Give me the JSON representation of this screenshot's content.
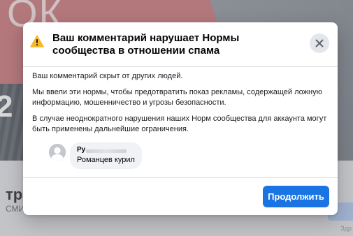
{
  "background": {
    "banner_text": "ОК",
    "banner_number": "2",
    "title": "тра",
    "subtitle": "СМИ/",
    "note": "Здр"
  },
  "dialog": {
    "title": "Ваш комментарий нарушает Нормы сообщества в отношении спама",
    "icon": "warning-triangle-icon",
    "close_icon": "close-icon",
    "paragraphs": [
      "Ваш комментарий скрыт от других людей.",
      "Мы ввели эти нормы, чтобы предотвратить показ рекламы, содержащей ложную информацию, мошенничество и угрозы безопасности.",
      "В случае неоднократного нарушения наших Норм сообщества для аккаунта могут быть применены дальнейшие ограничения."
    ],
    "comment": {
      "author": "Ру",
      "text": "Романцев курил"
    },
    "continue_label": "Продолжить"
  },
  "colors": {
    "accent": "#1b74e4",
    "warning": "#f7b928"
  }
}
